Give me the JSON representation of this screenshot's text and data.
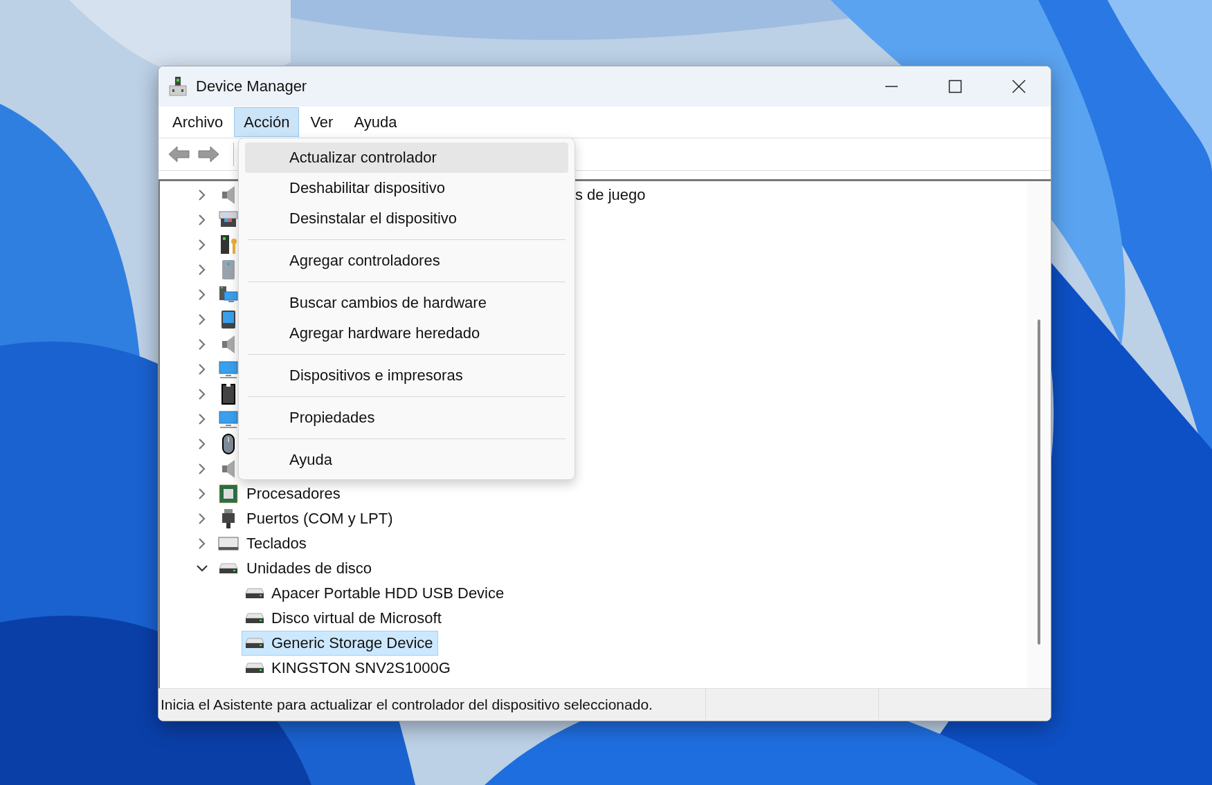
{
  "window": {
    "title": "Device Manager"
  },
  "menu_bar": [
    {
      "label": "Archivo",
      "selected": false
    },
    {
      "label": "Acción",
      "selected": true
    },
    {
      "label": "Ver",
      "selected": false
    },
    {
      "label": "Ayuda",
      "selected": false
    }
  ],
  "tree": {
    "items": [
      {
        "label": "s de juego",
        "expanded": false
      },
      {
        "expanded": false
      },
      {
        "expanded": false
      },
      {
        "expanded": false
      },
      {
        "expanded": false
      },
      {
        "expanded": false
      },
      {
        "expanded": false
      },
      {
        "expanded": false
      },
      {
        "expanded": false
      },
      {
        "expanded": false
      },
      {
        "expanded": false
      },
      {
        "expanded": false
      },
      {
        "label": "Procesadores",
        "expanded": false
      },
      {
        "label": "Puertos (COM y LPT)",
        "expanded": false
      },
      {
        "label": "Teclados",
        "expanded": false
      },
      {
        "label": "Unidades de disco",
        "expanded": true,
        "children": [
          {
            "label": "Apacer Portable HDD USB Device",
            "selected": false
          },
          {
            "label": "Disco virtual de Microsoft",
            "selected": false
          },
          {
            "label": "Generic Storage Device",
            "selected": true
          },
          {
            "label": "KINGSTON SNV2S1000G",
            "selected": false
          }
        ]
      }
    ]
  },
  "dropdown_menu": {
    "items": [
      {
        "kind": "item",
        "label": "Actualizar controlador",
        "selected": true
      },
      {
        "kind": "item",
        "label": "Deshabilitar dispositivo",
        "selected": false
      },
      {
        "kind": "item",
        "label": "Desinstalar el dispositivo",
        "selected": false
      },
      {
        "kind": "separator"
      },
      {
        "kind": "item",
        "label": "Agregar controladores",
        "selected": false
      },
      {
        "kind": "separator"
      },
      {
        "kind": "item",
        "label": "Buscar cambios de hardware",
        "selected": false
      },
      {
        "kind": "item",
        "label": "Agregar hardware heredado",
        "selected": false
      },
      {
        "kind": "separator"
      },
      {
        "kind": "item",
        "label": "Dispositivos e impresoras",
        "selected": false
      },
      {
        "kind": "separator"
      },
      {
        "kind": "item",
        "label": "Propiedades",
        "selected": false
      },
      {
        "kind": "separator"
      },
      {
        "kind": "item",
        "label": "Ayuda",
        "selected": false
      }
    ]
  },
  "status_bar": {
    "text": "Inicia el Asistente para actualizar el controlador del dispositivo seleccionado."
  }
}
